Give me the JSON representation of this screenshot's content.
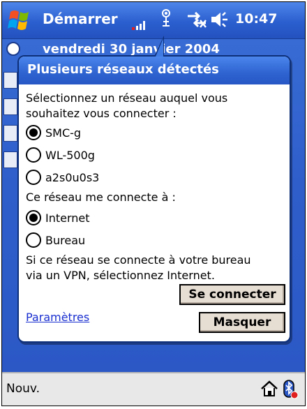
{
  "taskbar": {
    "start_label": "Démarrer",
    "time": "10:47",
    "icons": [
      "windows-flag-icon",
      "signal-strength-icon",
      "antenna-icon",
      "connectivity-icon",
      "volume-icon"
    ]
  },
  "today": {
    "date_text": "vendredi 30 janvier 2004"
  },
  "popup": {
    "title": "Plusieurs réseaux détectés",
    "instruction_line1": "Sélectionnez un réseau auquel vous",
    "instruction_line2": "souhaitez vous connecter :",
    "networks": [
      {
        "label": "SMC-g",
        "selected": true
      },
      {
        "label": "WL-500g",
        "selected": false
      },
      {
        "label": "a2s0u0s3",
        "selected": false
      }
    ],
    "connects_to_label": "Ce réseau me connecte à :",
    "destinations": [
      {
        "label": "Internet",
        "selected": true
      },
      {
        "label": "Bureau",
        "selected": false
      }
    ],
    "note_line1": "Si ce réseau se connecte à votre bureau",
    "note_line2": "via un VPN, sélectionnez Internet.",
    "connect_button": "Se connecter",
    "settings_link": "Paramètres",
    "hide_button": "Masquer"
  },
  "menubar": {
    "new_label": "Nouv.",
    "icons": [
      "home-icon",
      "bluetooth-icon"
    ]
  },
  "colors": {
    "title_bar": "#2b5fcf",
    "link": "#1a2fd0",
    "button_face": "#e6ddd3"
  }
}
